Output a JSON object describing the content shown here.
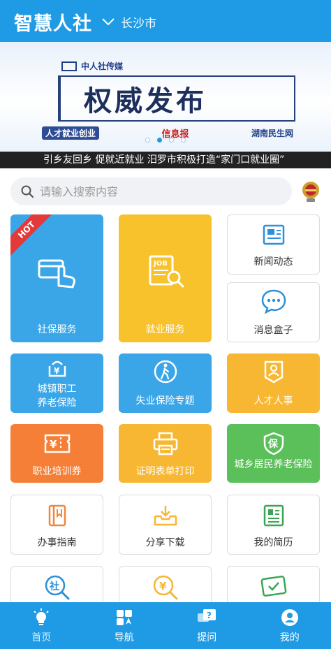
{
  "header": {
    "title": "智慧人社",
    "city": "长沙市"
  },
  "banner": {
    "brand": "中人社传媒",
    "headline": "权威发布",
    "partners": [
      "人才就业创业",
      "信息报",
      "湖南民生网"
    ],
    "dot_count": 4,
    "active_dot": 1
  },
  "ticker": {
    "text": "引乡友回乡 促就近就业 汨罗市积极打造“家门口就业圈”"
  },
  "search": {
    "placeholder": "请输入搜索内容"
  },
  "tiles": {
    "social_security": {
      "label": "社保服务",
      "badge": "HOT",
      "color": "#3aa6e8"
    },
    "employment": {
      "label": "就业服务",
      "color": "#f7c22b"
    },
    "news": {
      "label": "新闻动态"
    },
    "messages": {
      "label": "消息盒子"
    },
    "pension": {
      "label_line1": "城镇职工",
      "label_line2": "养老保险",
      "color": "#3aa6e8"
    },
    "unemployment": {
      "label": "失业保险专题",
      "color": "#3aa6e8"
    },
    "talent": {
      "label": "人才人事",
      "color": "#f7b733"
    },
    "training": {
      "label": "职业培训券",
      "color": "#f57f36"
    },
    "certificate": {
      "label": "证明表单打印",
      "color": "#f7b733"
    },
    "rural_pension": {
      "label": "城乡居民养老保险",
      "color": "#5cc05a"
    },
    "guide": {
      "label": "办事指南"
    },
    "download": {
      "label": "分享下载"
    },
    "resume": {
      "label": "我的简历"
    }
  },
  "tabbar": {
    "items": [
      {
        "label": "首页",
        "icon": "home-bulb-icon",
        "active": true
      },
      {
        "label": "导航",
        "icon": "navigation-grid-icon",
        "active": false
      },
      {
        "label": "提问",
        "icon": "question-chat-icon",
        "active": false
      },
      {
        "label": "我的",
        "icon": "user-profile-icon",
        "active": false
      }
    ]
  }
}
